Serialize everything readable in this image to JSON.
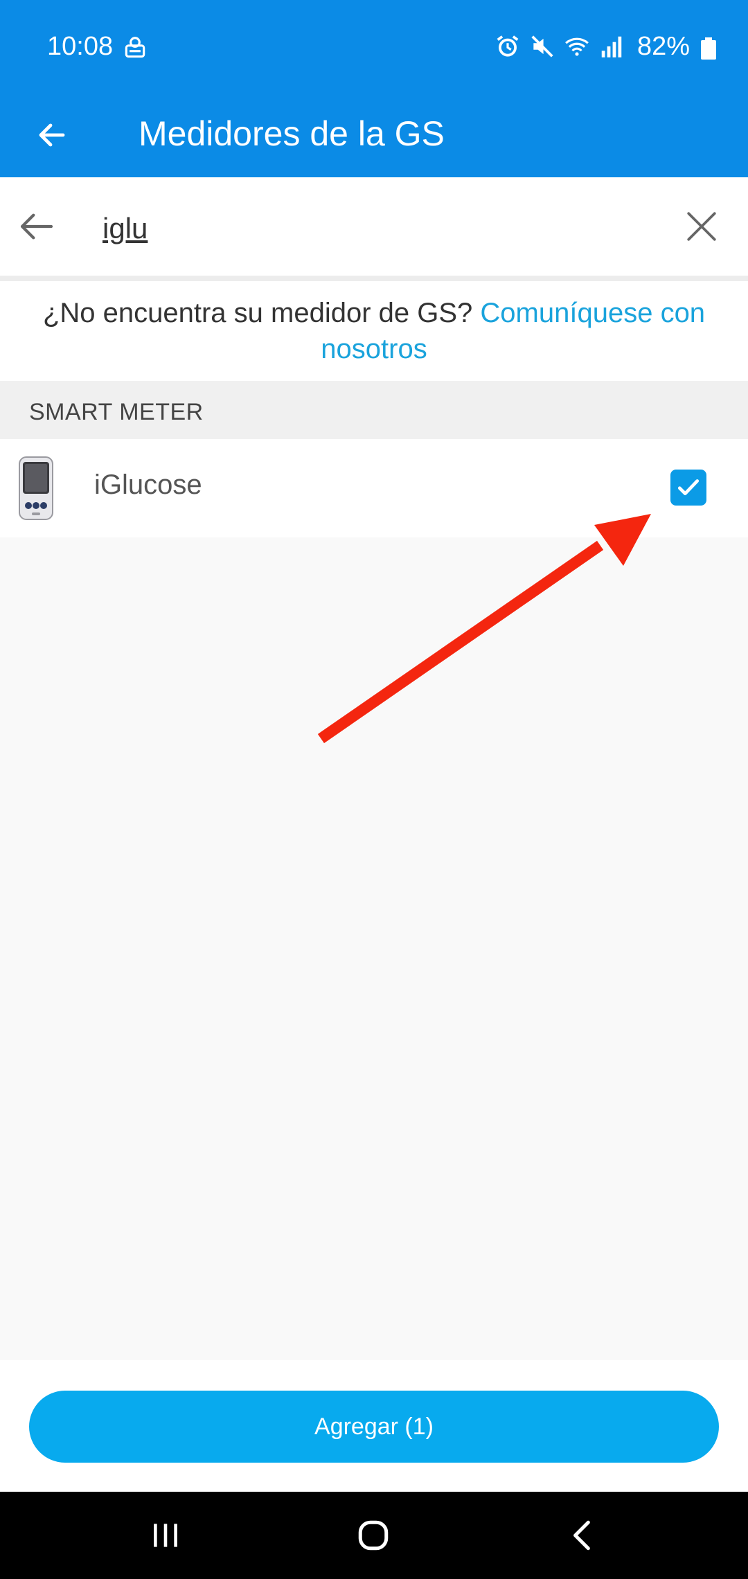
{
  "status_bar": {
    "time": "10:08",
    "battery": "82%",
    "icons": [
      "notification-icon",
      "alarm-icon",
      "mute-icon",
      "wifi-icon",
      "signal-icon",
      "battery-icon"
    ]
  },
  "app_bar": {
    "title": "Medidores de la GS",
    "back_icon": "arrow-left-icon"
  },
  "search": {
    "value": "iglu",
    "back_icon": "arrow-left-icon",
    "clear_icon": "close-icon"
  },
  "help": {
    "text": "¿No encuentra su medidor de GS?",
    "link": "Comuníquese con nosotros"
  },
  "section": {
    "title": "SMART METER"
  },
  "meters": [
    {
      "name": "iGlucose",
      "checked": true,
      "icon": "glucose-meter-icon"
    }
  ],
  "footer": {
    "add_label": "Agregar (1)"
  },
  "colors": {
    "primary": "#0b8be6",
    "accent": "#08aaee",
    "link": "#1aa3dc",
    "annotation": "#f4260f"
  }
}
